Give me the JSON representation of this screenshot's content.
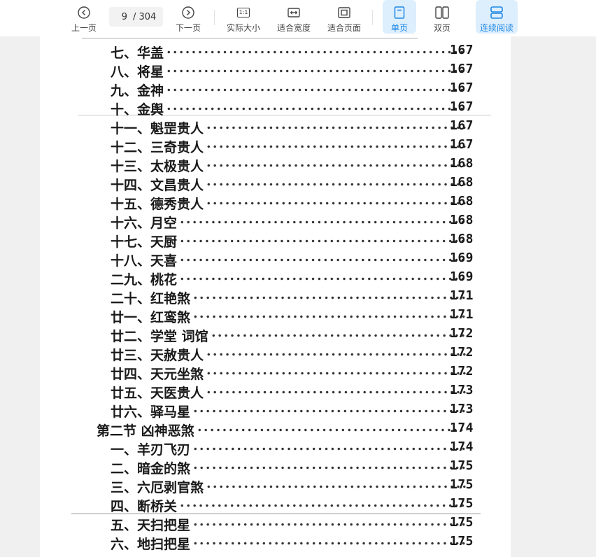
{
  "toolbar": {
    "prev_label": "上一页",
    "current_page": "9",
    "total_pages": "/ 304",
    "next_label": "下一页",
    "actual_size_label": "实际大小",
    "actual_size_icon_text": "1:1",
    "fit_width_label": "适合宽度",
    "fit_page_label": "适合页面",
    "single_page_label": "单页",
    "double_page_label": "双页",
    "continuous_label": "连续阅读",
    "accent_color": "#1e88e5"
  },
  "document": {
    "entries": [
      {
        "title": "七、华盖",
        "page": "167"
      },
      {
        "title": "八、将星",
        "page": "167"
      },
      {
        "title": "九、金神",
        "page": "167"
      },
      {
        "title": "十、金舆",
        "page": "167"
      },
      {
        "title": "十一、魁罡贵人",
        "page": "167"
      },
      {
        "title": "十二、三奇贵人",
        "page": "167"
      },
      {
        "title": "十三、太极贵人",
        "page": "168"
      },
      {
        "title": "十四、文昌贵人",
        "page": "168"
      },
      {
        "title": "十五、德秀贵人",
        "page": "168"
      },
      {
        "title": "十六、月空",
        "page": "168"
      },
      {
        "title": "十七、天厨",
        "page": "168"
      },
      {
        "title": "十八、天喜",
        "page": "169"
      },
      {
        "title": "二九、桃花",
        "page": "169"
      },
      {
        "title": "二十、红艳煞",
        "page": "171"
      },
      {
        "title": "廿一、红鸾煞",
        "page": "171"
      },
      {
        "title": "廿二、学堂 词馆",
        "page": "172"
      },
      {
        "title": "廿三、天赦贵人",
        "page": "172"
      },
      {
        "title": "廿四、天元坐煞",
        "page": "172"
      },
      {
        "title": "廿五、天医贵人",
        "page": "173"
      },
      {
        "title": "廿六、驿马星",
        "page": "173"
      },
      {
        "title": "第二节 凶神恶煞",
        "page": "174",
        "section": true
      },
      {
        "title": "一、羊刃飞刃",
        "page": "174"
      },
      {
        "title": "二、暗金的煞",
        "page": "175"
      },
      {
        "title": "三、六厄剥官煞",
        "page": "175"
      },
      {
        "title": "四、断桥关",
        "page": "175"
      },
      {
        "title": "五、天扫把星",
        "page": "175"
      },
      {
        "title": "六、地扫把星",
        "page": "175"
      }
    ]
  }
}
